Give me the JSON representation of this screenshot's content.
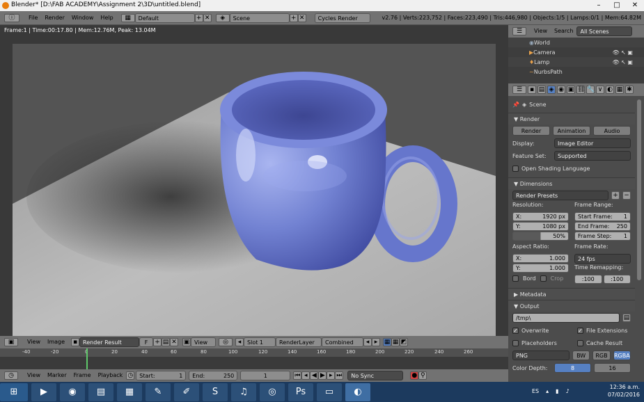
{
  "window": {
    "title": "Blender* [D:\\FAB ACADEMY\\Assignment 2\\3D\\untitled.blend]",
    "controls": [
      "–",
      "□",
      "✕"
    ]
  },
  "info_header": {
    "menus": [
      "File",
      "Render",
      "Window",
      "Help"
    ],
    "layout": "Default",
    "scene": "Scene",
    "engine": "Cycles Render",
    "stats": "v2.76 | Verts:223,752 | Faces:223,490 | Tris:446,980 | Objects:1/5 | Lamps:0/1 | Mem:64.82M"
  },
  "image_editor": {
    "frame_info": "Frame:1 | Time:00:17.80 | Mem:12.76M, Peak: 13.04M",
    "header": {
      "menus": [
        "View",
        "Image"
      ],
      "image_name": "Render Result",
      "fake_user": "F",
      "view": "View",
      "slot": "Slot 1",
      "layer": "RenderLayer",
      "pass": "Combined"
    }
  },
  "timeline": {
    "ticks": [
      "-40",
      "-20",
      "0",
      "20",
      "40",
      "60",
      "80",
      "100",
      "120",
      "140",
      "160",
      "180",
      "200",
      "220",
      "240",
      "260"
    ],
    "header": {
      "menus": [
        "View",
        "Marker",
        "Frame",
        "Playback"
      ],
      "start_label": "Start:",
      "start_value": "1",
      "end_label": "End:",
      "end_value": "250",
      "current_frame": "1",
      "sync": "No Sync"
    }
  },
  "outliner": {
    "header": {
      "view": "View",
      "search": "Search",
      "filter": "All Scenes"
    },
    "items": [
      "World",
      "Camera",
      "Lamp",
      "NurbsPath"
    ]
  },
  "properties": {
    "context": "Scene",
    "render": {
      "title": "Render",
      "buttons": [
        "Render",
        "Animation",
        "Audio"
      ],
      "display_label": "Display:",
      "display_value": "Image Editor",
      "feature_label": "Feature Set:",
      "feature_value": "Supported",
      "osl_label": "Open Shading Language"
    },
    "dimensions": {
      "title": "Dimensions",
      "presets": "Render Presets",
      "resolution_label": "Resolution:",
      "res_x_label": "X:",
      "res_x": "1920 px",
      "res_y_label": "Y:",
      "res_y": "1080 px",
      "res_pct": "50%",
      "frame_range_label": "Frame Range:",
      "start_label": "Start Frame:",
      "start": "1",
      "end_label": "End Frame:",
      "end": "250",
      "step_label": "Frame Step:",
      "step": "1",
      "aspect_label": "Aspect Ratio:",
      "asp_x_label": "X:",
      "asp_x": "1.000",
      "asp_y_label": "Y:",
      "asp_y": "1.000",
      "frame_rate_label": "Frame Rate:",
      "frame_rate": "24 fps",
      "border_label": "Bord",
      "crop_label": "Crop",
      "remap_label": "Time Remapping:",
      "remap_old": ":100",
      "remap_new": ":100"
    },
    "metadata": {
      "title": "Metadata"
    },
    "output": {
      "title": "Output",
      "path": "/tmp\\",
      "overwrite": "Overwrite",
      "file_ext": "File Extensions",
      "placeholders": "Placeholders",
      "cache": "Cache Result",
      "format": "PNG",
      "color_modes": [
        "BW",
        "RGB",
        "RGBA"
      ],
      "color_depth_label": "Color Depth:",
      "depths": [
        "8",
        "16"
      ]
    }
  },
  "taskbar": {
    "language": "ES",
    "time": "12:36 a.m.",
    "date": "07/02/2016"
  },
  "colors": {
    "accent_blue": "#5680c2",
    "timeline_cursor": "#5fc86a",
    "cup": "#6f7fd0"
  }
}
